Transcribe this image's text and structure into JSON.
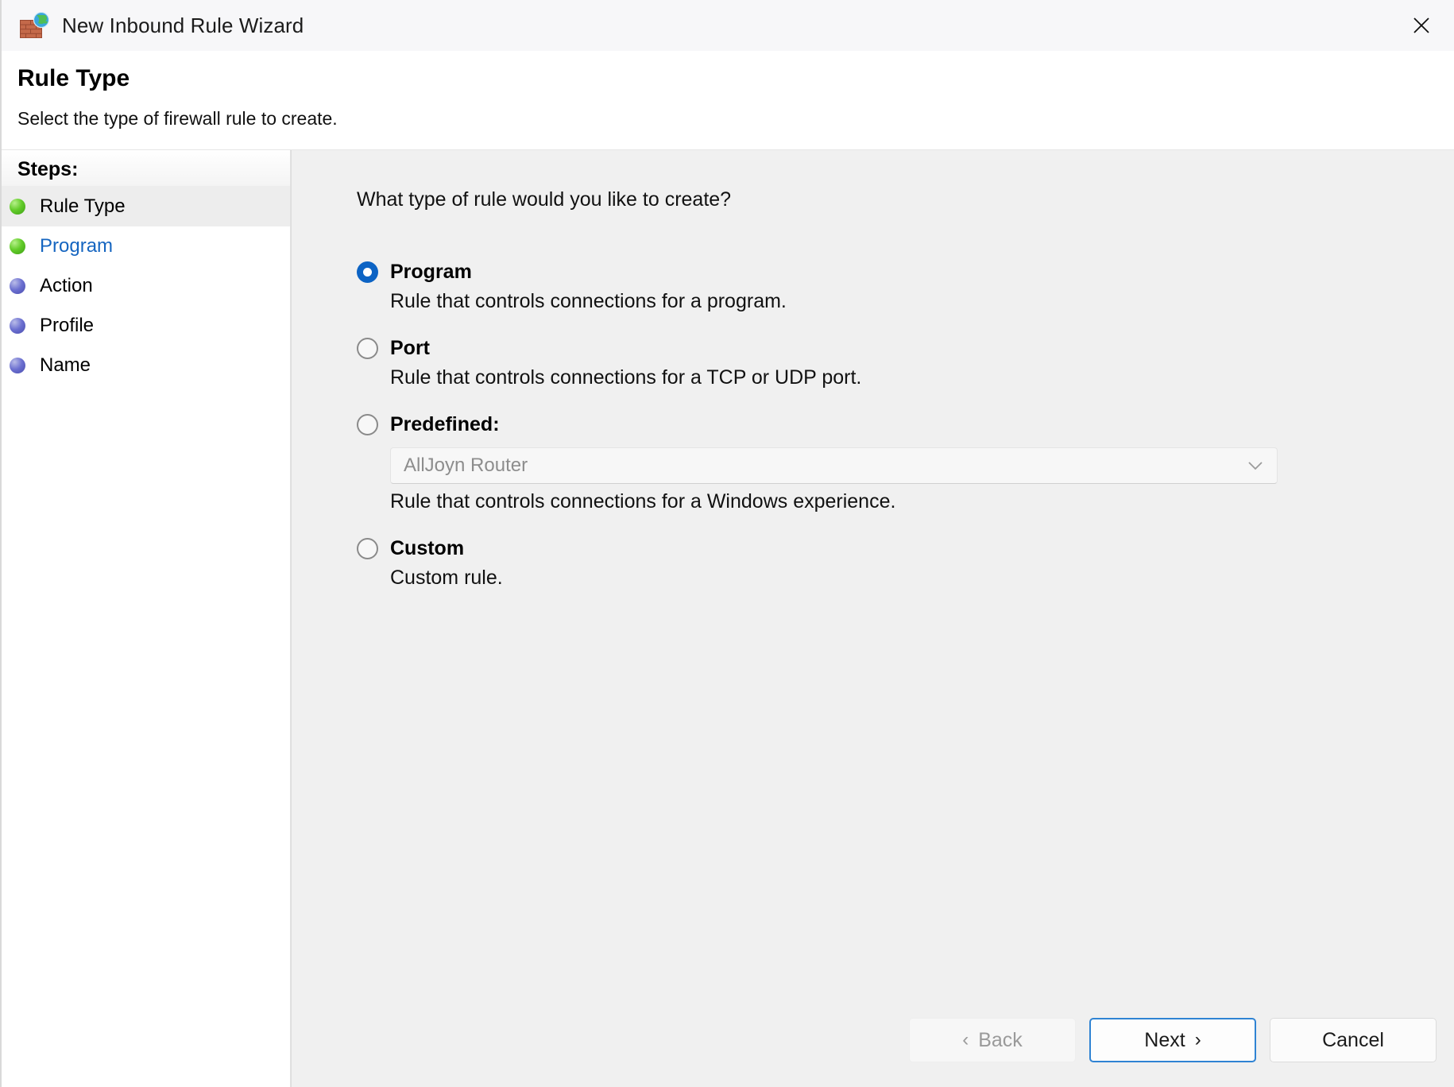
{
  "window": {
    "title": "New Inbound Rule Wizard",
    "icon": "firewall-globe-icon",
    "close_label": "✕"
  },
  "header": {
    "title": "Rule Type",
    "subtitle": "Select the type of firewall rule to create."
  },
  "sidebar": {
    "heading": "Steps:",
    "items": [
      {
        "label": "Rule Type",
        "state": "current",
        "bullet": "green-sphere-icon"
      },
      {
        "label": "Program",
        "state": "link",
        "bullet": "green-sphere-icon"
      },
      {
        "label": "Action",
        "state": "pending",
        "bullet": "blue-sphere-icon"
      },
      {
        "label": "Profile",
        "state": "pending",
        "bullet": "blue-sphere-icon"
      },
      {
        "label": "Name",
        "state": "pending",
        "bullet": "blue-sphere-icon"
      }
    ]
  },
  "main": {
    "question": "What type of rule would you like to create?",
    "options": [
      {
        "label": "Program",
        "description": "Rule that controls connections for a program.",
        "selected": true
      },
      {
        "label": "Port",
        "description": "Rule that controls connections for a TCP or UDP port.",
        "selected": false
      },
      {
        "label": "Predefined:",
        "description": "Rule that controls connections for a Windows experience.",
        "selected": false,
        "combo_value": "AllJoyn Router"
      },
      {
        "label": "Custom",
        "description": "Custom rule.",
        "selected": false
      }
    ]
  },
  "footer": {
    "back_label": "Back",
    "back_chevron": "‹",
    "next_label": "Next",
    "next_chevron": "›",
    "cancel_label": "Cancel"
  },
  "colors": {
    "accent": "#0c63c4",
    "link": "#1565c0",
    "focus_border": "#2f83d3",
    "panel_bg": "#f0f0f0",
    "disabled_text": "#9a9a9a"
  }
}
